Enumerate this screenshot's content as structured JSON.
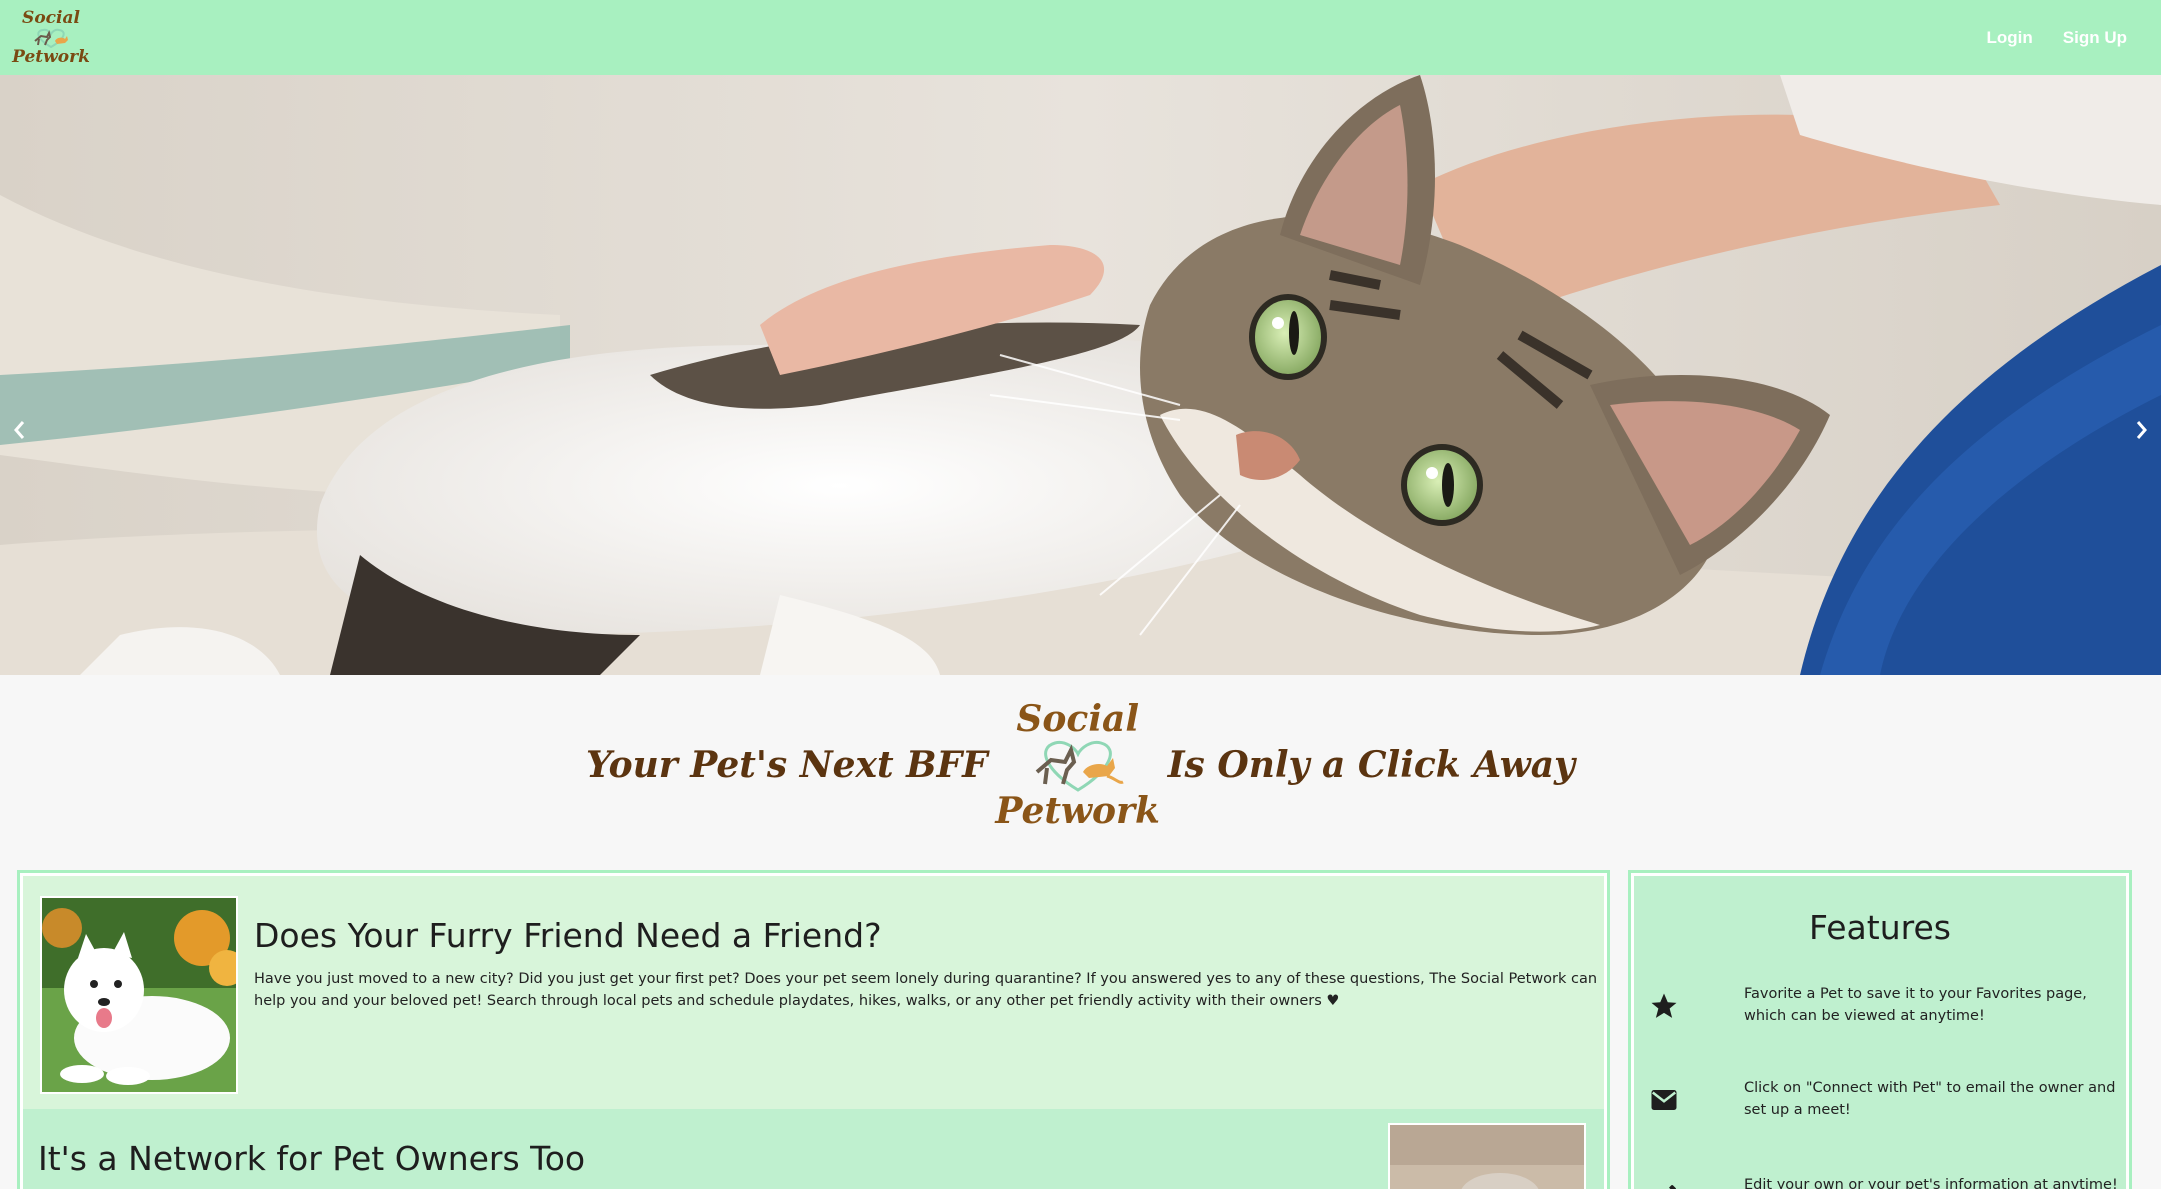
{
  "brand": {
    "logo_line1": "Social",
    "logo_line2": "Petwork"
  },
  "nav": {
    "login_label": "Login",
    "signup_label": "Sign Up"
  },
  "hero": {
    "prev_icon": "chevron-left-icon",
    "next_icon": "chevron-right-icon"
  },
  "tagline": {
    "left": "Your Pet's Next BFF",
    "right": "Is Only a Click Away"
  },
  "intro": {
    "title": "Does Your Furry Friend Need a Friend?",
    "body": "Have you just moved to a new city? Did you just get your first pet? Does your pet seem lonely during quarantine? If you answered yes to any of these questions, The Social Petwork can help you and your beloved pet! Search through local pets and schedule playdates, hikes, walks, or any other pet friendly activity with their owners ♥"
  },
  "owners": {
    "title": "It's a Network for Pet Owners Too"
  },
  "features": {
    "title": "Features",
    "items": [
      {
        "icon": "star-icon",
        "text": "Favorite a Pet to save it to your Favorites page, which can be viewed at anytime!"
      },
      {
        "icon": "envelope-icon",
        "text": "Click on \"Connect with Pet\" to email the owner and set up a meet!"
      },
      {
        "icon": "pencil-icon",
        "text": "Edit your own or your pet's information at anytime!"
      }
    ]
  },
  "colors": {
    "nav_bg": "#a8f0c0",
    "brand_brown": "#7a4a12",
    "section_light": "#d8f5da",
    "section_mint": "#bff0cf"
  }
}
